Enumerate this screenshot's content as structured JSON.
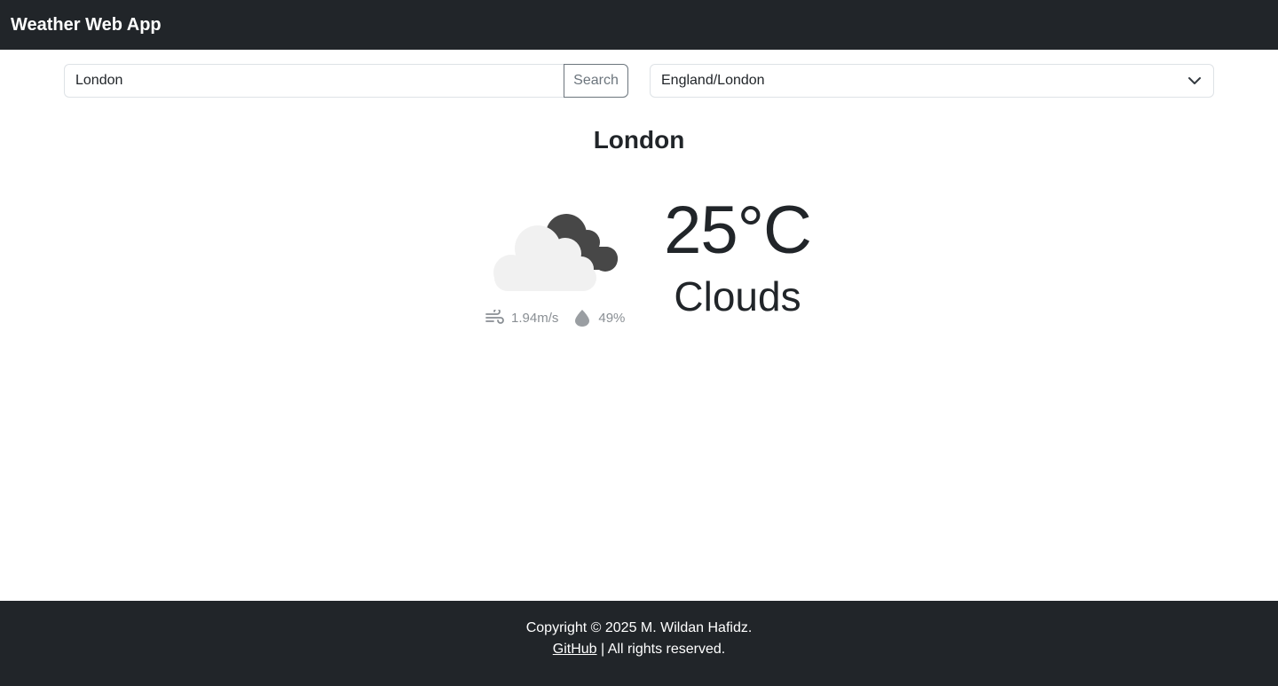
{
  "navbar": {
    "brand": "Weather Web App"
  },
  "search": {
    "value": "London",
    "button_label": "Search"
  },
  "timezone_select": {
    "selected": "England/London"
  },
  "weather": {
    "city": "London",
    "temperature": "25°C",
    "condition": "Clouds",
    "wind": "1.94m/s",
    "humidity": "49%",
    "icon": "clouds-icon"
  },
  "footer": {
    "copyright": "Copyright © 2025 M. Wildan Hafidz.",
    "github_link": "GitHub",
    "rights": " | All rights reserved."
  }
}
